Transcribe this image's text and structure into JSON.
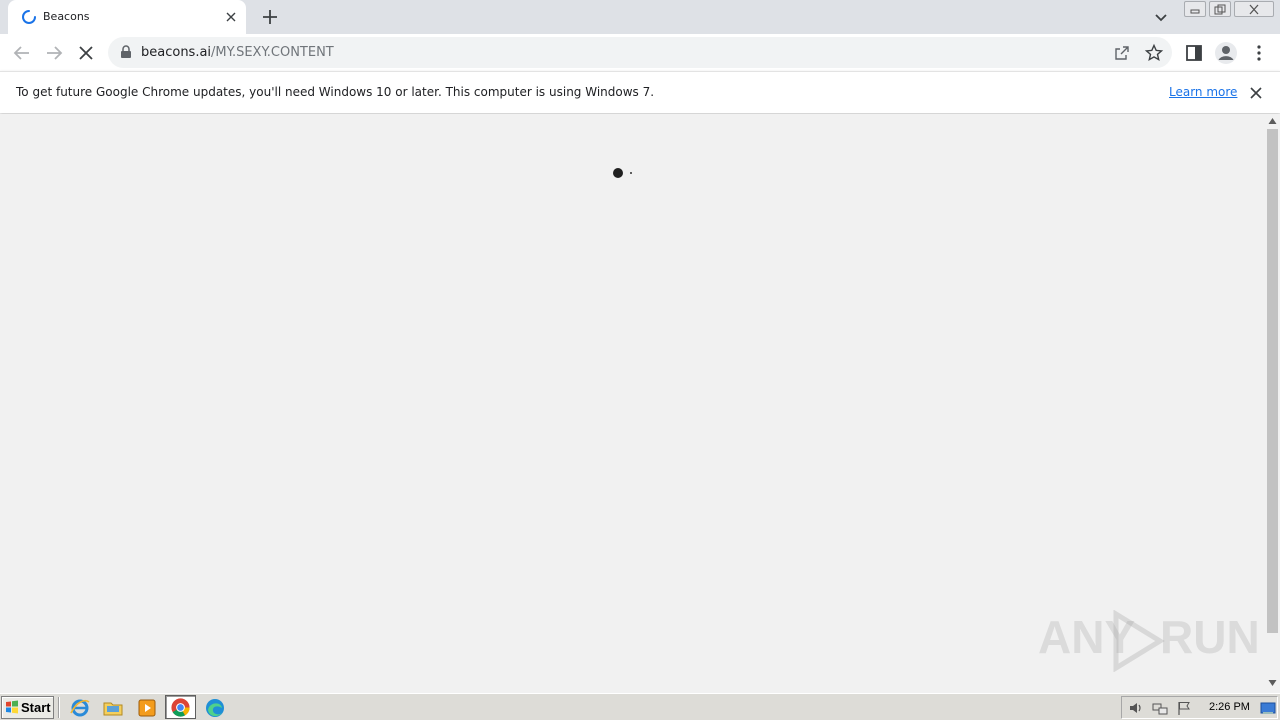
{
  "browser": {
    "tab": {
      "title": "Beacons"
    },
    "omnibox": {
      "url_host": "beacons.ai",
      "url_path": "/MY.SEXY.CONTENT"
    }
  },
  "infobar": {
    "message": "To get future Google Chrome updates, you'll need Windows 10 or later. This computer is using Windows 7.",
    "link": "Learn more"
  },
  "watermark": {
    "left": "ANY",
    "right": "RUN"
  },
  "taskbar": {
    "start_label": "Start",
    "clock": "2:26 PM",
    "pinned": [
      "internet-explorer-icon",
      "folder-icon",
      "media-player-icon",
      "chrome-icon",
      "edge-icon"
    ]
  },
  "colors": {
    "tabstrip": "#dee1e6",
    "page_background": "#f1f1f1",
    "link": "#1a73e8",
    "spinner": "#1a73e8"
  }
}
